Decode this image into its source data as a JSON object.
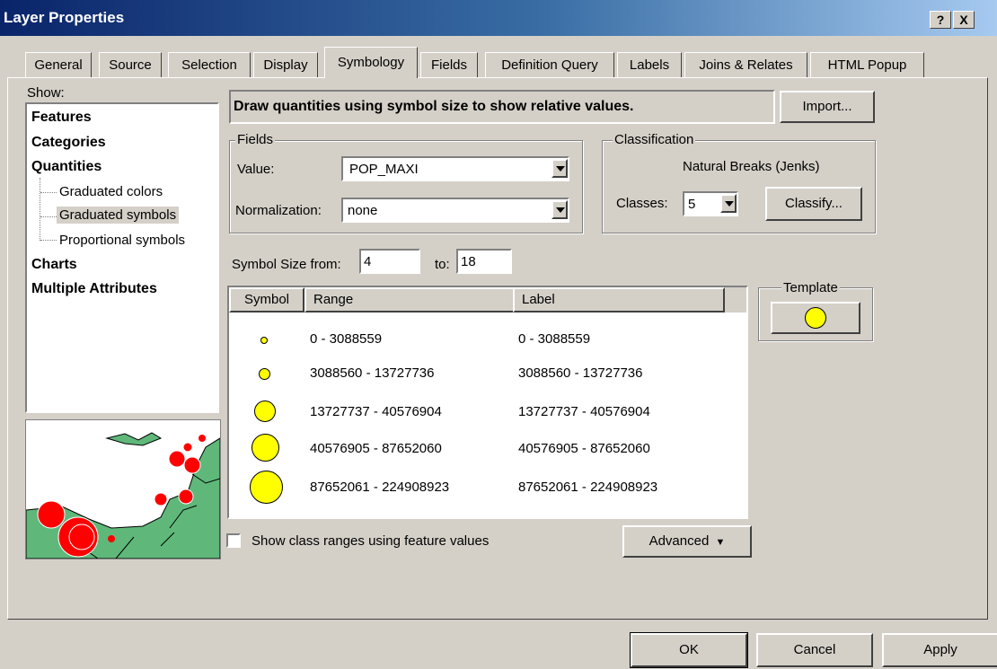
{
  "window": {
    "title": "Layer Properties",
    "help_icon": "?",
    "close_icon": "X"
  },
  "tabs": [
    {
      "label": "General"
    },
    {
      "label": "Source"
    },
    {
      "label": "Selection"
    },
    {
      "label": "Display"
    },
    {
      "label": "Symbology",
      "active": true
    },
    {
      "label": "Fields"
    },
    {
      "label": "Definition Query"
    },
    {
      "label": "Labels"
    },
    {
      "label": "Joins & Relates"
    },
    {
      "label": "HTML Popup"
    }
  ],
  "show": {
    "label": "Show:",
    "items": [
      {
        "label": "Features",
        "bold": true
      },
      {
        "label": "Categories",
        "bold": true
      },
      {
        "label": "Quantities",
        "bold": true
      },
      {
        "label": "Graduated colors",
        "child": true
      },
      {
        "label": "Graduated symbols",
        "child": true,
        "selected": true
      },
      {
        "label": "Proportional symbols",
        "child": true
      },
      {
        "label": "Charts",
        "bold": true
      },
      {
        "label": "Multiple Attributes",
        "bold": true
      }
    ]
  },
  "description": "Draw quantities using symbol size to show relative values.",
  "import_button": "Import...",
  "fields": {
    "group_label": "Fields",
    "value_label": "Value:",
    "value": "POP_MAXI",
    "normalization_label": "Normalization:",
    "normalization": "none"
  },
  "classification": {
    "group_label": "Classification",
    "method": "Natural Breaks (Jenks)",
    "classes_label": "Classes:",
    "classes": "5",
    "classify_button": "Classify..."
  },
  "symbol_size": {
    "from_label": "Symbol Size from:",
    "from": "4",
    "to_label": "to:",
    "to": "18"
  },
  "table": {
    "headers": [
      "Symbol",
      "Range",
      "Label"
    ],
    "rows": [
      {
        "range": "0 - 3088559",
        "label": "0 - 3088559"
      },
      {
        "range": "3088560 - 13727736",
        "label": "3088560 - 13727736"
      },
      {
        "range": "13727737 - 40576904",
        "label": "13727737 - 40576904"
      },
      {
        "range": "40576905 - 87652060",
        "label": "40576905 - 87652060"
      },
      {
        "range": "87652061 - 224908923",
        "label": "87652061 - 224908923"
      }
    ]
  },
  "template": {
    "label": "Template"
  },
  "show_class_ranges": {
    "label": "Show class ranges using feature values",
    "checked": false
  },
  "advanced_button": "Advanced",
  "buttons": {
    "ok": "OK",
    "cancel": "Cancel",
    "apply": "Apply"
  },
  "colors": {
    "titlebar": "#0a246a",
    "symbol_fill": "#ffff00",
    "map_sea": "#ffffff",
    "map_land": "#5fb87a",
    "map_point": "#ff0000"
  }
}
